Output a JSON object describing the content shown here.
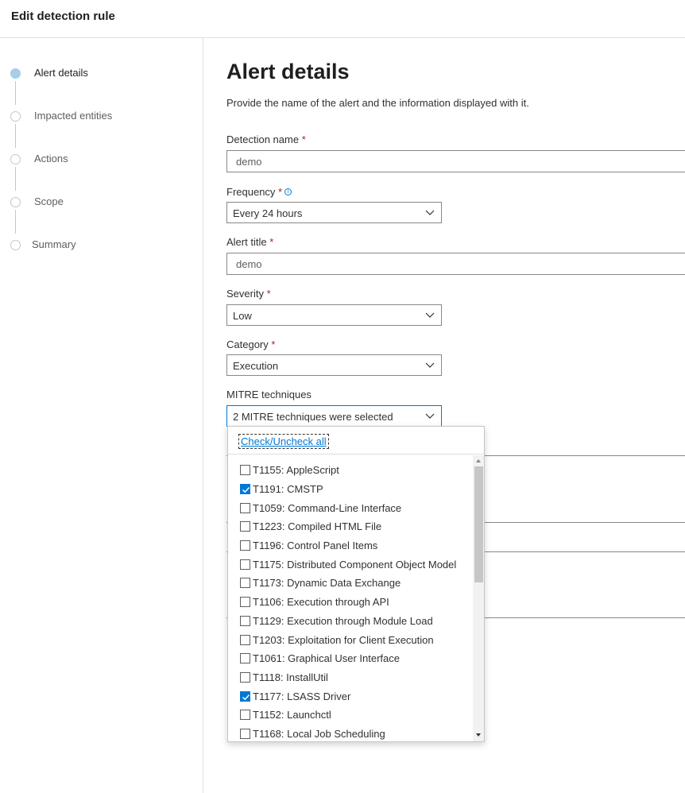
{
  "window": {
    "title": "Edit detection rule"
  },
  "steps": [
    {
      "label": "Alert details",
      "active": true
    },
    {
      "label": "Impacted entities",
      "active": false
    },
    {
      "label": "Actions",
      "active": false
    },
    {
      "label": "Scope",
      "active": false
    },
    {
      "label": "Summary",
      "active": false
    }
  ],
  "page": {
    "title": "Alert details",
    "description": "Provide the name of the alert and the information displayed with it."
  },
  "form": {
    "detection_name": {
      "label": "Detection name",
      "value": "demo",
      "required": "*"
    },
    "frequency": {
      "label": "Frequency",
      "value": "Every 24 hours",
      "required": "*",
      "info_icon": "info-icon"
    },
    "alert_title": {
      "label": "Alert title",
      "value": "demo",
      "required": "*"
    },
    "severity": {
      "label": "Severity",
      "value": "Low",
      "required": "*"
    },
    "category": {
      "label": "Category",
      "value": "Execution",
      "required": "*"
    },
    "mitre": {
      "label": "MITRE techniques",
      "value": "2 MITRE techniques were selected"
    }
  },
  "mitre_popup": {
    "check_all": "Check/Uncheck all",
    "options": [
      {
        "label": "T1155: AppleScript",
        "checked": false
      },
      {
        "label": "T1191: CMSTP",
        "checked": true
      },
      {
        "label": "T1059: Command-Line Interface",
        "checked": false
      },
      {
        "label": "T1223: Compiled HTML File",
        "checked": false
      },
      {
        "label": "T1196: Control Panel Items",
        "checked": false
      },
      {
        "label": "T1175: Distributed Component Object Model",
        "checked": false
      },
      {
        "label": "T1173: Dynamic Data Exchange",
        "checked": false
      },
      {
        "label": "T1106: Execution through API",
        "checked": false
      },
      {
        "label": "T1129: Execution through Module Load",
        "checked": false
      },
      {
        "label": "T1203: Exploitation for Client Execution",
        "checked": false
      },
      {
        "label": "T1061: Graphical User Interface",
        "checked": false
      },
      {
        "label": "T1118: InstallUtil",
        "checked": false
      },
      {
        "label": "T1177: LSASS Driver",
        "checked": true
      },
      {
        "label": "T1152: Launchctl",
        "checked": false
      },
      {
        "label": "T1168: Local Job Scheduling",
        "checked": false
      }
    ]
  },
  "colors": {
    "accent": "#0078d4",
    "required": "#a4262c",
    "active_step": "#a6cde9"
  }
}
